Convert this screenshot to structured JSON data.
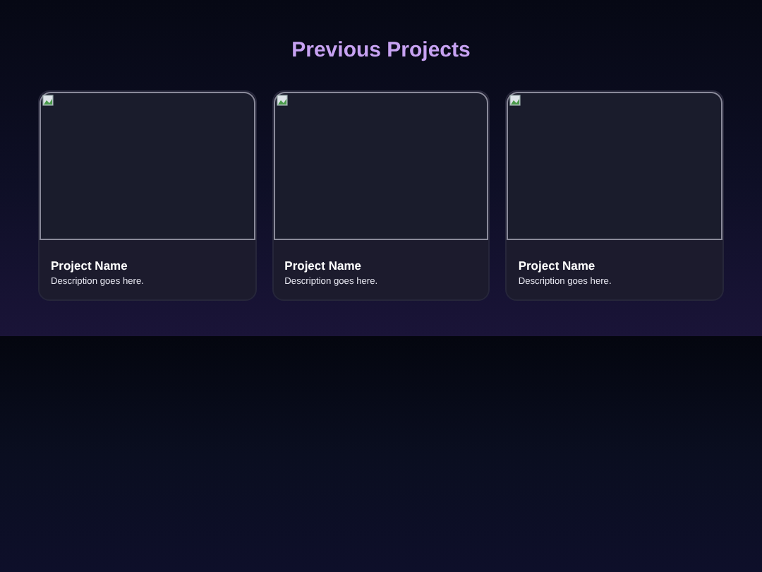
{
  "section": {
    "title": "Previous Projects"
  },
  "projects": [
    {
      "name": "Project Name",
      "description": "Description goes here."
    },
    {
      "name": "Project Name",
      "description": "Description goes here."
    },
    {
      "name": "Project Name",
      "description": "Description goes here."
    }
  ]
}
